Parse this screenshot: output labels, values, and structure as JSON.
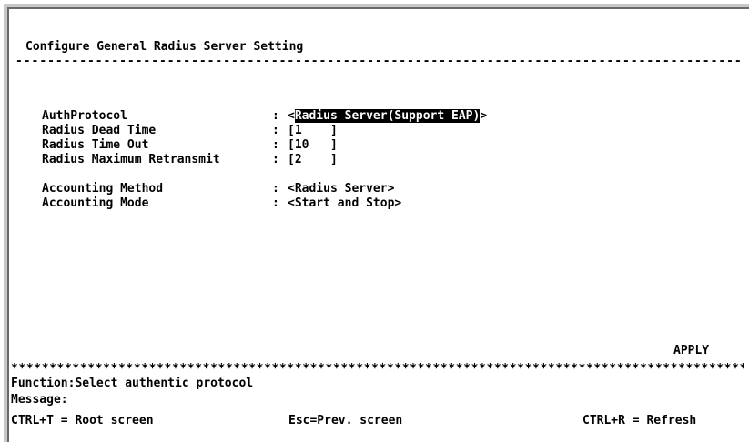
{
  "screen": {
    "title": "Configure General Radius Server Setting",
    "title_rule": "---------------------------------------------------------------------------------------------"
  },
  "fields": [
    {
      "label": "AuthProtocol",
      "colon": ":",
      "open": "<",
      "value": "Radius Server(Support EAP)",
      "close": ">",
      "highlighted": true
    },
    {
      "label": "Radius Dead Time",
      "colon": ":",
      "value": "[1    ]"
    },
    {
      "label": "Radius Time Out",
      "colon": ":",
      "value": "[10   ]"
    },
    {
      "label": "Radius Maximum Retransmit",
      "colon": ":",
      "value": "[2    ]"
    },
    {
      "label": "Accounting Method",
      "colon": ":",
      "value": "<Radius Server>"
    },
    {
      "label": "Accounting Mode",
      "colon": ":",
      "value": "<Start and Stop>"
    }
  ],
  "actions": {
    "apply_label": "APPLY"
  },
  "footer": {
    "separator": "*****************************************************************************************************",
    "function_text": "Function:Select authentic protocol",
    "message_text": "Message:",
    "hints": [
      "CTRL+T = Root screen",
      "Esc=Prev. screen",
      "CTRL+R = Refresh"
    ]
  },
  "colors": {
    "background": "#ffffff",
    "text": "#000000",
    "highlight_bg": "#000000",
    "highlight_fg": "#ffffff"
  }
}
